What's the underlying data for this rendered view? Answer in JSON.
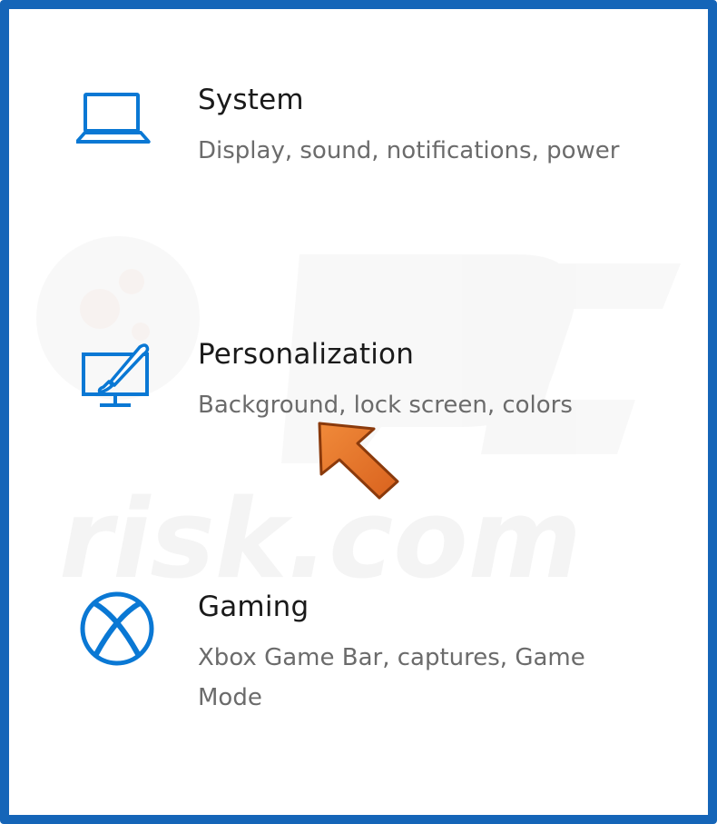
{
  "settings": {
    "items": [
      {
        "icon": "laptop-icon",
        "title": "System",
        "description": "Display, sound, notifications, power"
      },
      {
        "icon": "personalization-paintbrush-monitor-icon",
        "title": "Personalization",
        "description": "Background, lock screen, colors"
      },
      {
        "icon": "xbox-icon",
        "title": "Gaming",
        "description": "Xbox Game Bar, captures, Game Mode"
      }
    ]
  },
  "colors": {
    "border": "#1565b8",
    "icon": "#0a78d4",
    "arrow": "#e3752b",
    "title_text": "#1a1a1a",
    "desc_text": "#6b6b6b"
  },
  "annotation": {
    "icon": "pointer-arrow-icon",
    "color": "#e3752b"
  }
}
